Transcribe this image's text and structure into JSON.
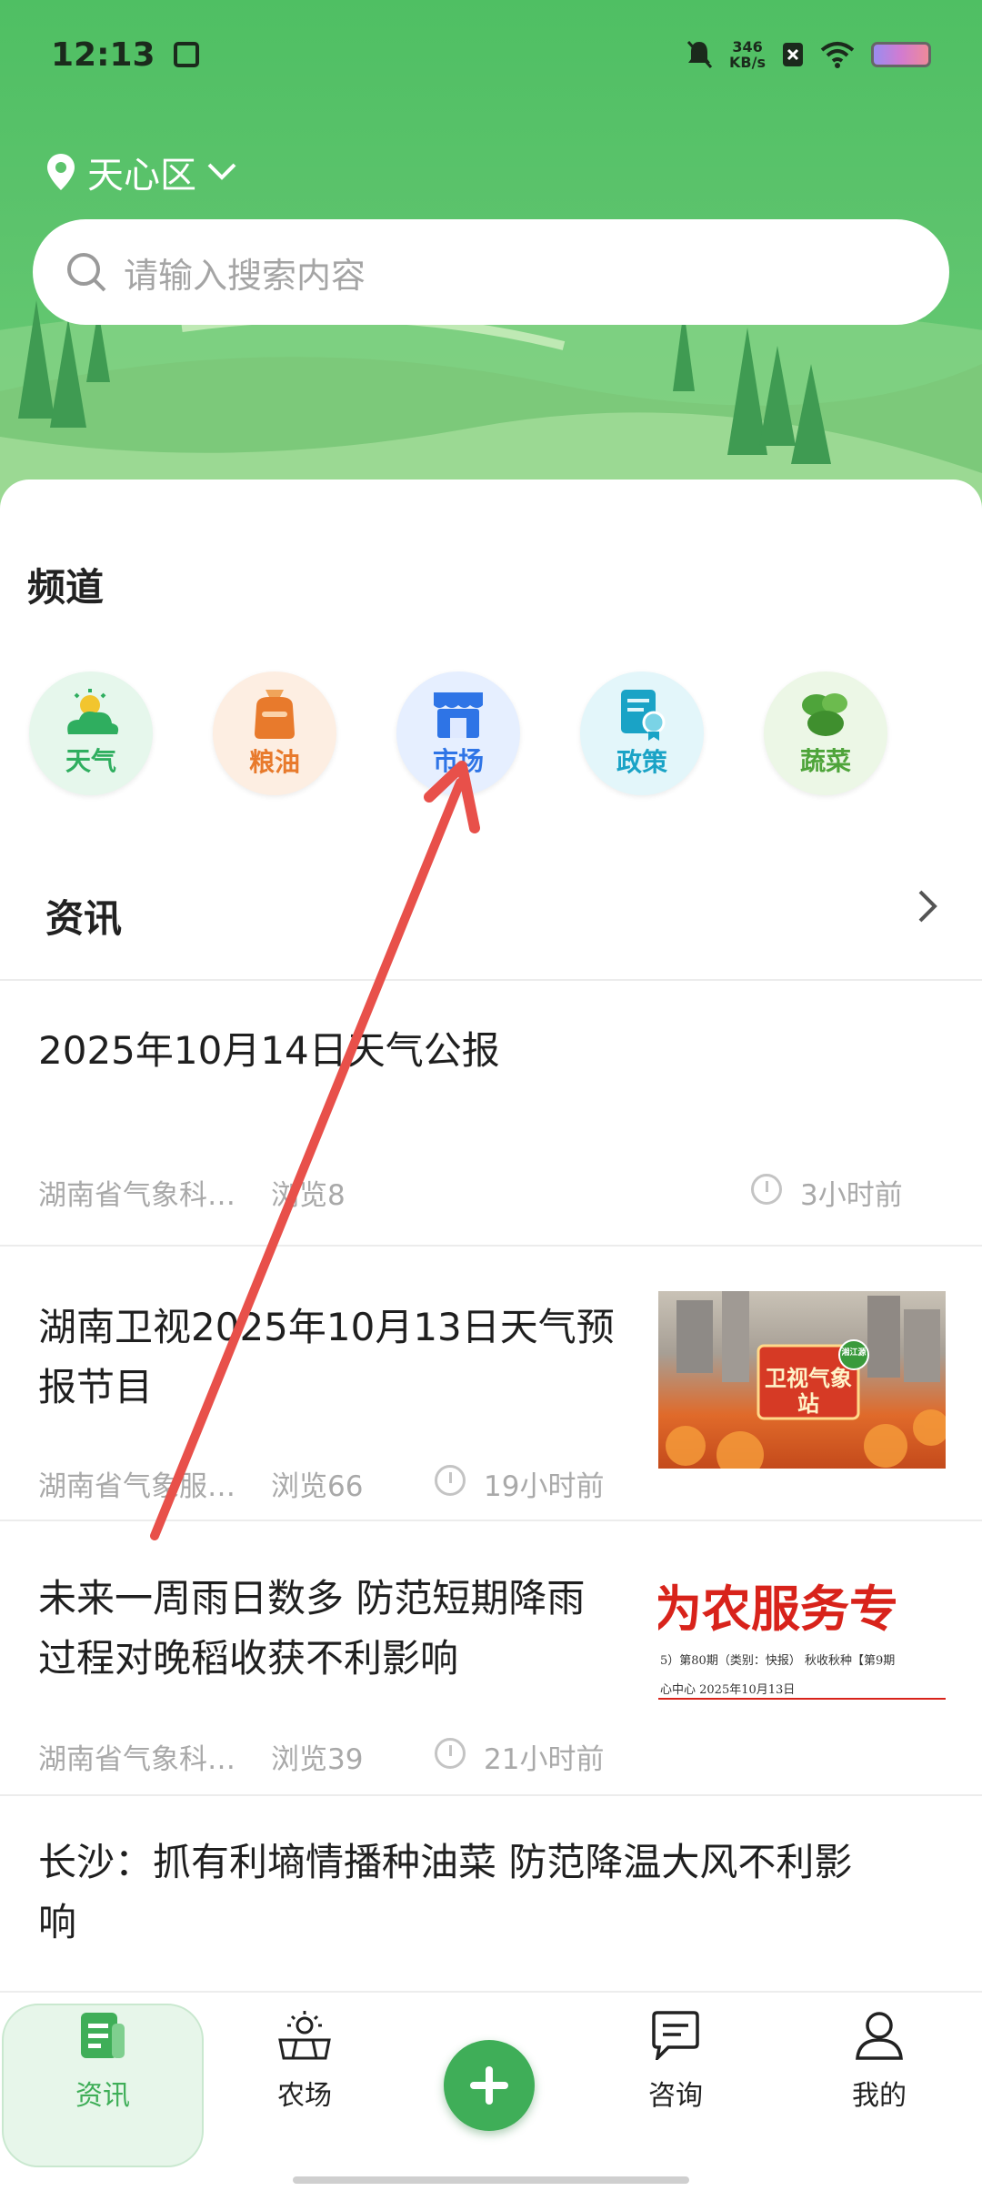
{
  "status_bar": {
    "time": "12:13",
    "network_speed_value": "346",
    "network_speed_unit": "KB/s"
  },
  "location": {
    "label": "天心区"
  },
  "search": {
    "placeholder": "请输入搜索内容"
  },
  "channels": {
    "title": "频道",
    "items": [
      {
        "label": "天气",
        "icon": "weather-icon",
        "color": "#2fae5f"
      },
      {
        "label": "粮油",
        "icon": "grain-oil-icon",
        "color": "#e87a2c"
      },
      {
        "label": "市场",
        "icon": "market-icon",
        "color": "#2e74e6"
      },
      {
        "label": "政策",
        "icon": "policy-icon",
        "color": "#1aa3c6"
      },
      {
        "label": "蔬菜",
        "icon": "vegetable-icon",
        "color": "#4ea43a"
      }
    ]
  },
  "news": {
    "title": "资讯",
    "items": [
      {
        "title": "2025年10月14日天气公报",
        "source": "湖南省气象科…",
        "views": "浏览8",
        "time": "3小时前"
      },
      {
        "title_line1": "湖南卫视2025年10月13日天气预",
        "title_line2": "报节目",
        "source": "湖南省气象服…",
        "views": "浏览66",
        "time": "19小时前",
        "thumb_text": "卫视气象站",
        "thumb_badge": "湘江源"
      },
      {
        "title_line1": "未来一周雨日数多 防范短期降雨",
        "title_line2": "过程对晚稻收获不利影响",
        "source": "湖南省气象科…",
        "views": "浏览39",
        "time": "21小时前",
        "thumb_text": "为农服务专",
        "thumb_sub1": "5）第80期（类别：快报）    秋收秋种【第9期",
        "thumb_sub2": "心中心          2025年10月13日"
      },
      {
        "title_line1": "长沙：抓有利墒情播种油菜 防范降温大风不利影",
        "title_line2": "响"
      }
    ]
  },
  "tabbar": {
    "items": [
      {
        "label": "资讯",
        "icon": "news-icon",
        "active": true
      },
      {
        "label": "农场",
        "icon": "farm-icon"
      },
      {
        "label": "咨询",
        "icon": "chat-icon"
      },
      {
        "label": "我的",
        "icon": "profile-icon"
      }
    ],
    "fab_icon": "plus-icon"
  },
  "colors": {
    "primary_green": "#3fae58",
    "annotation_arrow": "#e8504a"
  }
}
